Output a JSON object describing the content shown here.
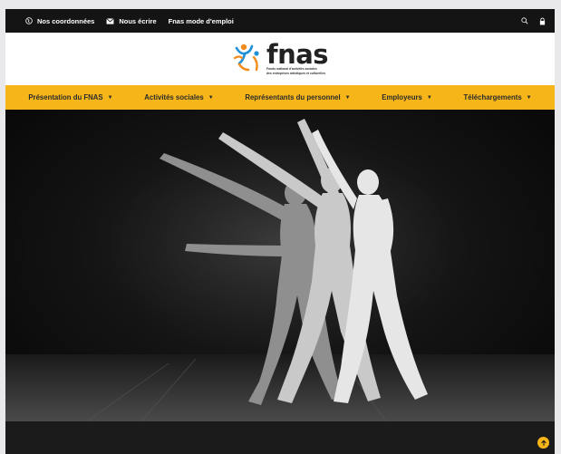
{
  "topbar": {
    "links": [
      {
        "label": "Nos coordonnées",
        "icon": "globe-icon"
      },
      {
        "label": "Nous écrire",
        "icon": "envelope-icon"
      },
      {
        "label": "Fnas mode d'emploi",
        "icon": ""
      }
    ],
    "search_icon": "search-icon",
    "lock_icon": "lock-icon"
  },
  "logo": {
    "word": "fnas",
    "subtitle_line1": "Fonds national d'activités sociales",
    "subtitle_line2": "des entreprises artistiques et culturelles"
  },
  "nav": {
    "items": [
      {
        "label": "Présentation du FNAS"
      },
      {
        "label": "Activités sociales"
      },
      {
        "label": "Représentants du personnel"
      },
      {
        "label": "Employeurs"
      },
      {
        "label": "Téléchargements"
      }
    ]
  },
  "colors": {
    "accent": "#f6b619",
    "topbar": "#141414",
    "hero": "#0a0a0a",
    "logo_blue": "#1f8fd6",
    "logo_orange": "#f28c1e"
  },
  "scroll_top_icon": "arrow-up-icon"
}
